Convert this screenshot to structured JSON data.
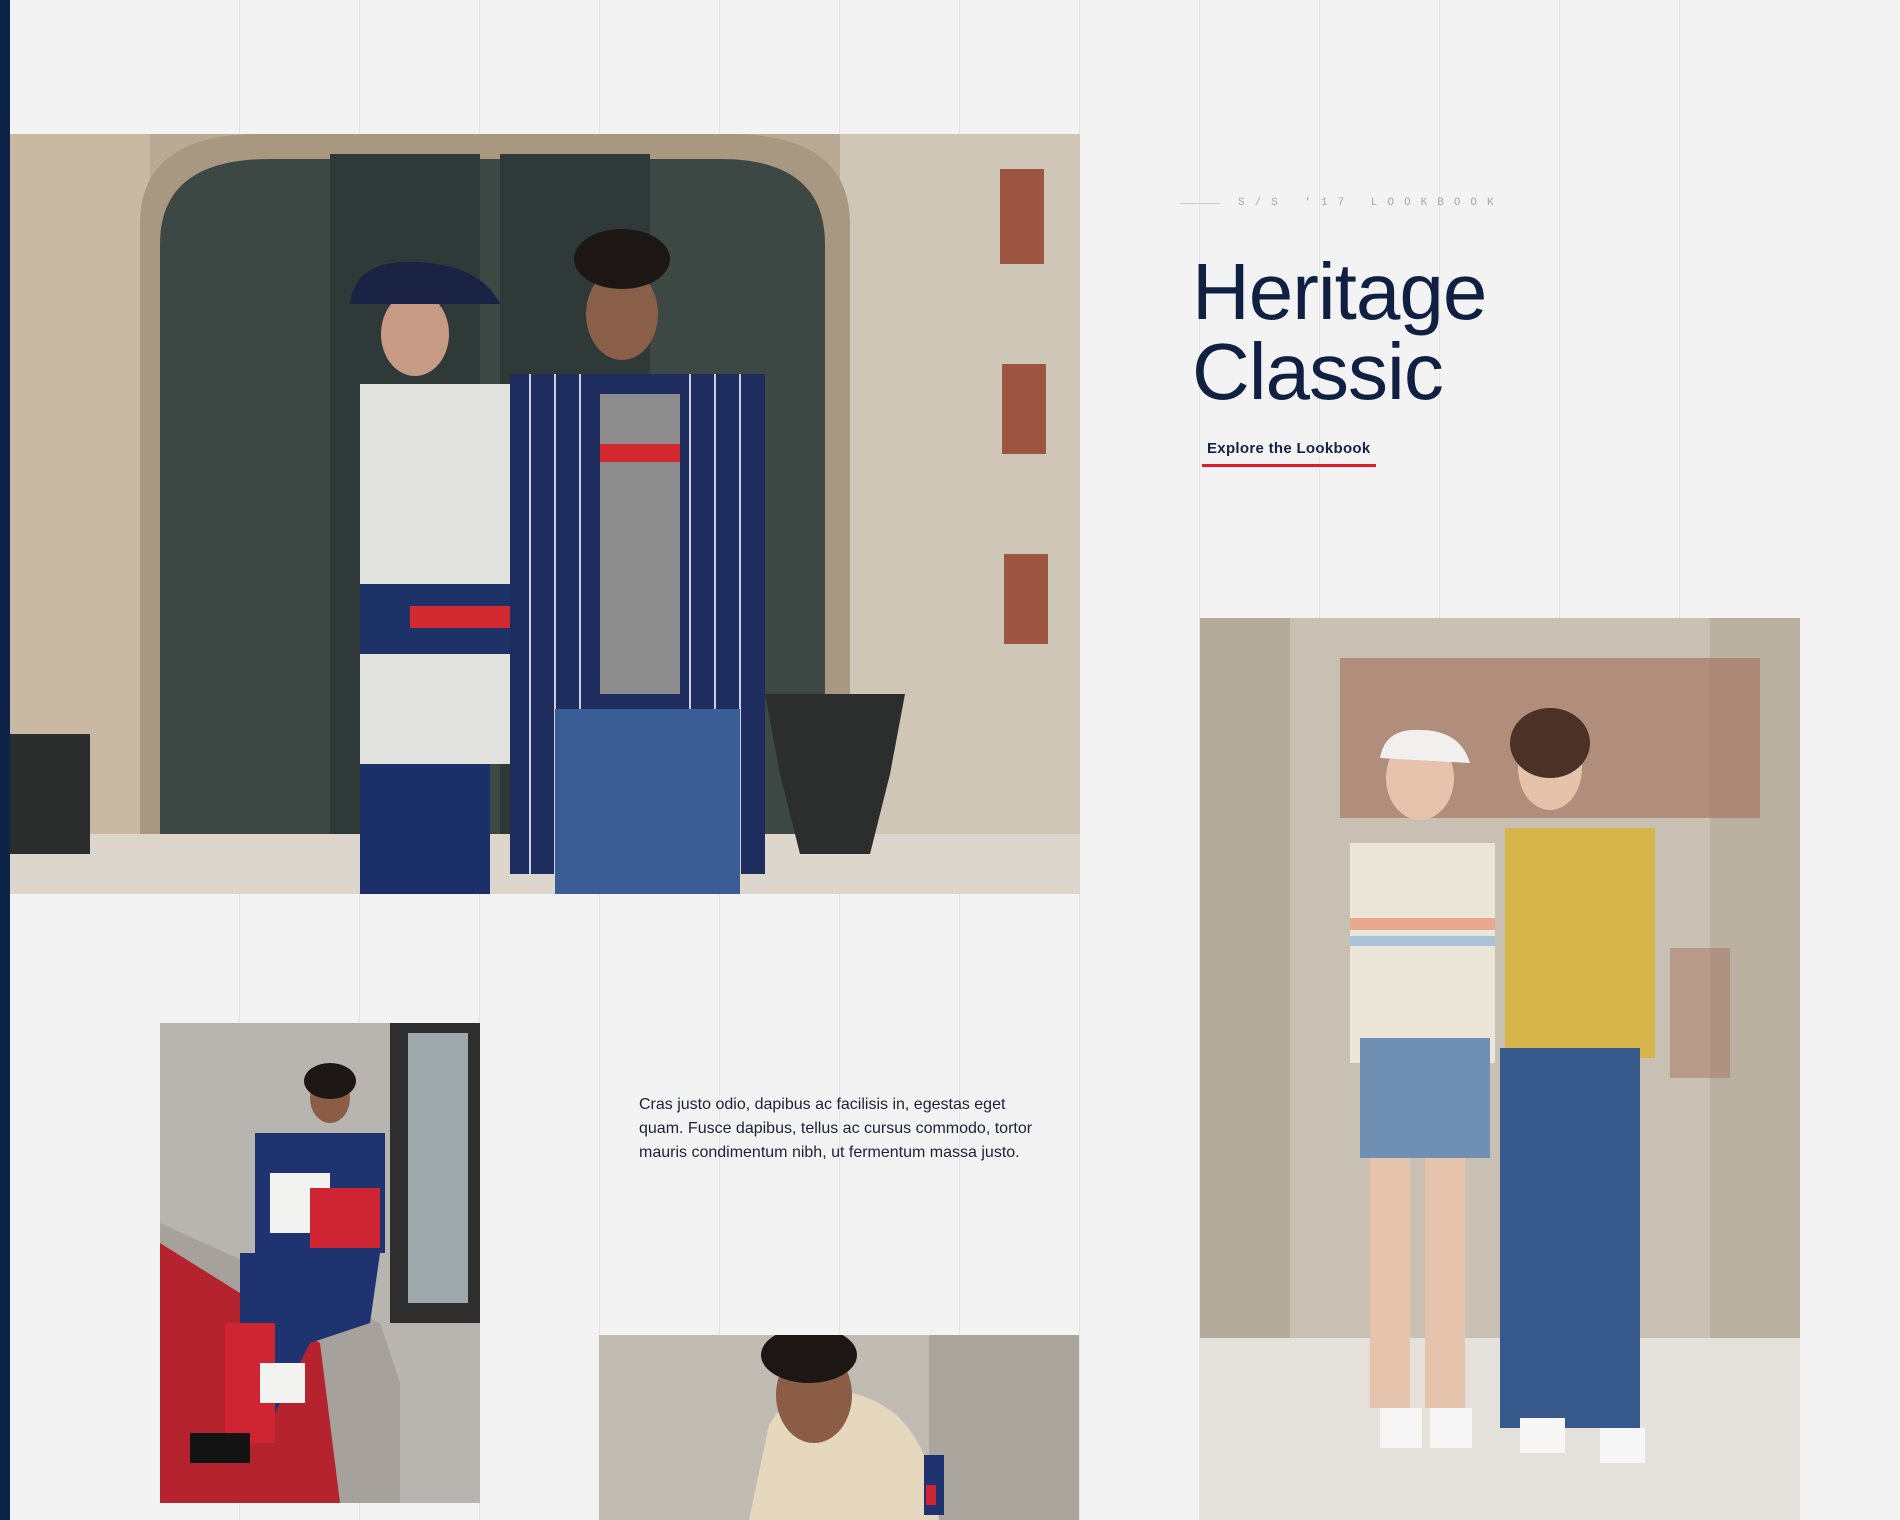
{
  "hero": {
    "eyebrow": "S/S '17 LOOKBOOK",
    "title_line1": "Heritage",
    "title_line2": "Classic",
    "cta_label": "Explore the Lookbook"
  },
  "body_text": "Cras justo odio, dapibus ac facilisis in, egestas eget quam. Fusce dapibus, tellus ac cursus commodo, tortor mauris condimentum nibh, ut fermentum massa justo.",
  "images": {
    "main": "two-men-courtyard-photo",
    "women": "two-women-courtyard-photo",
    "stairs": "man-on-red-stairs-photo",
    "jacket": "man-sherpa-jacket-photo"
  },
  "colors": {
    "navy": "#0f2043",
    "accent_red": "#e11b2e",
    "background": "#f3f3f3"
  }
}
